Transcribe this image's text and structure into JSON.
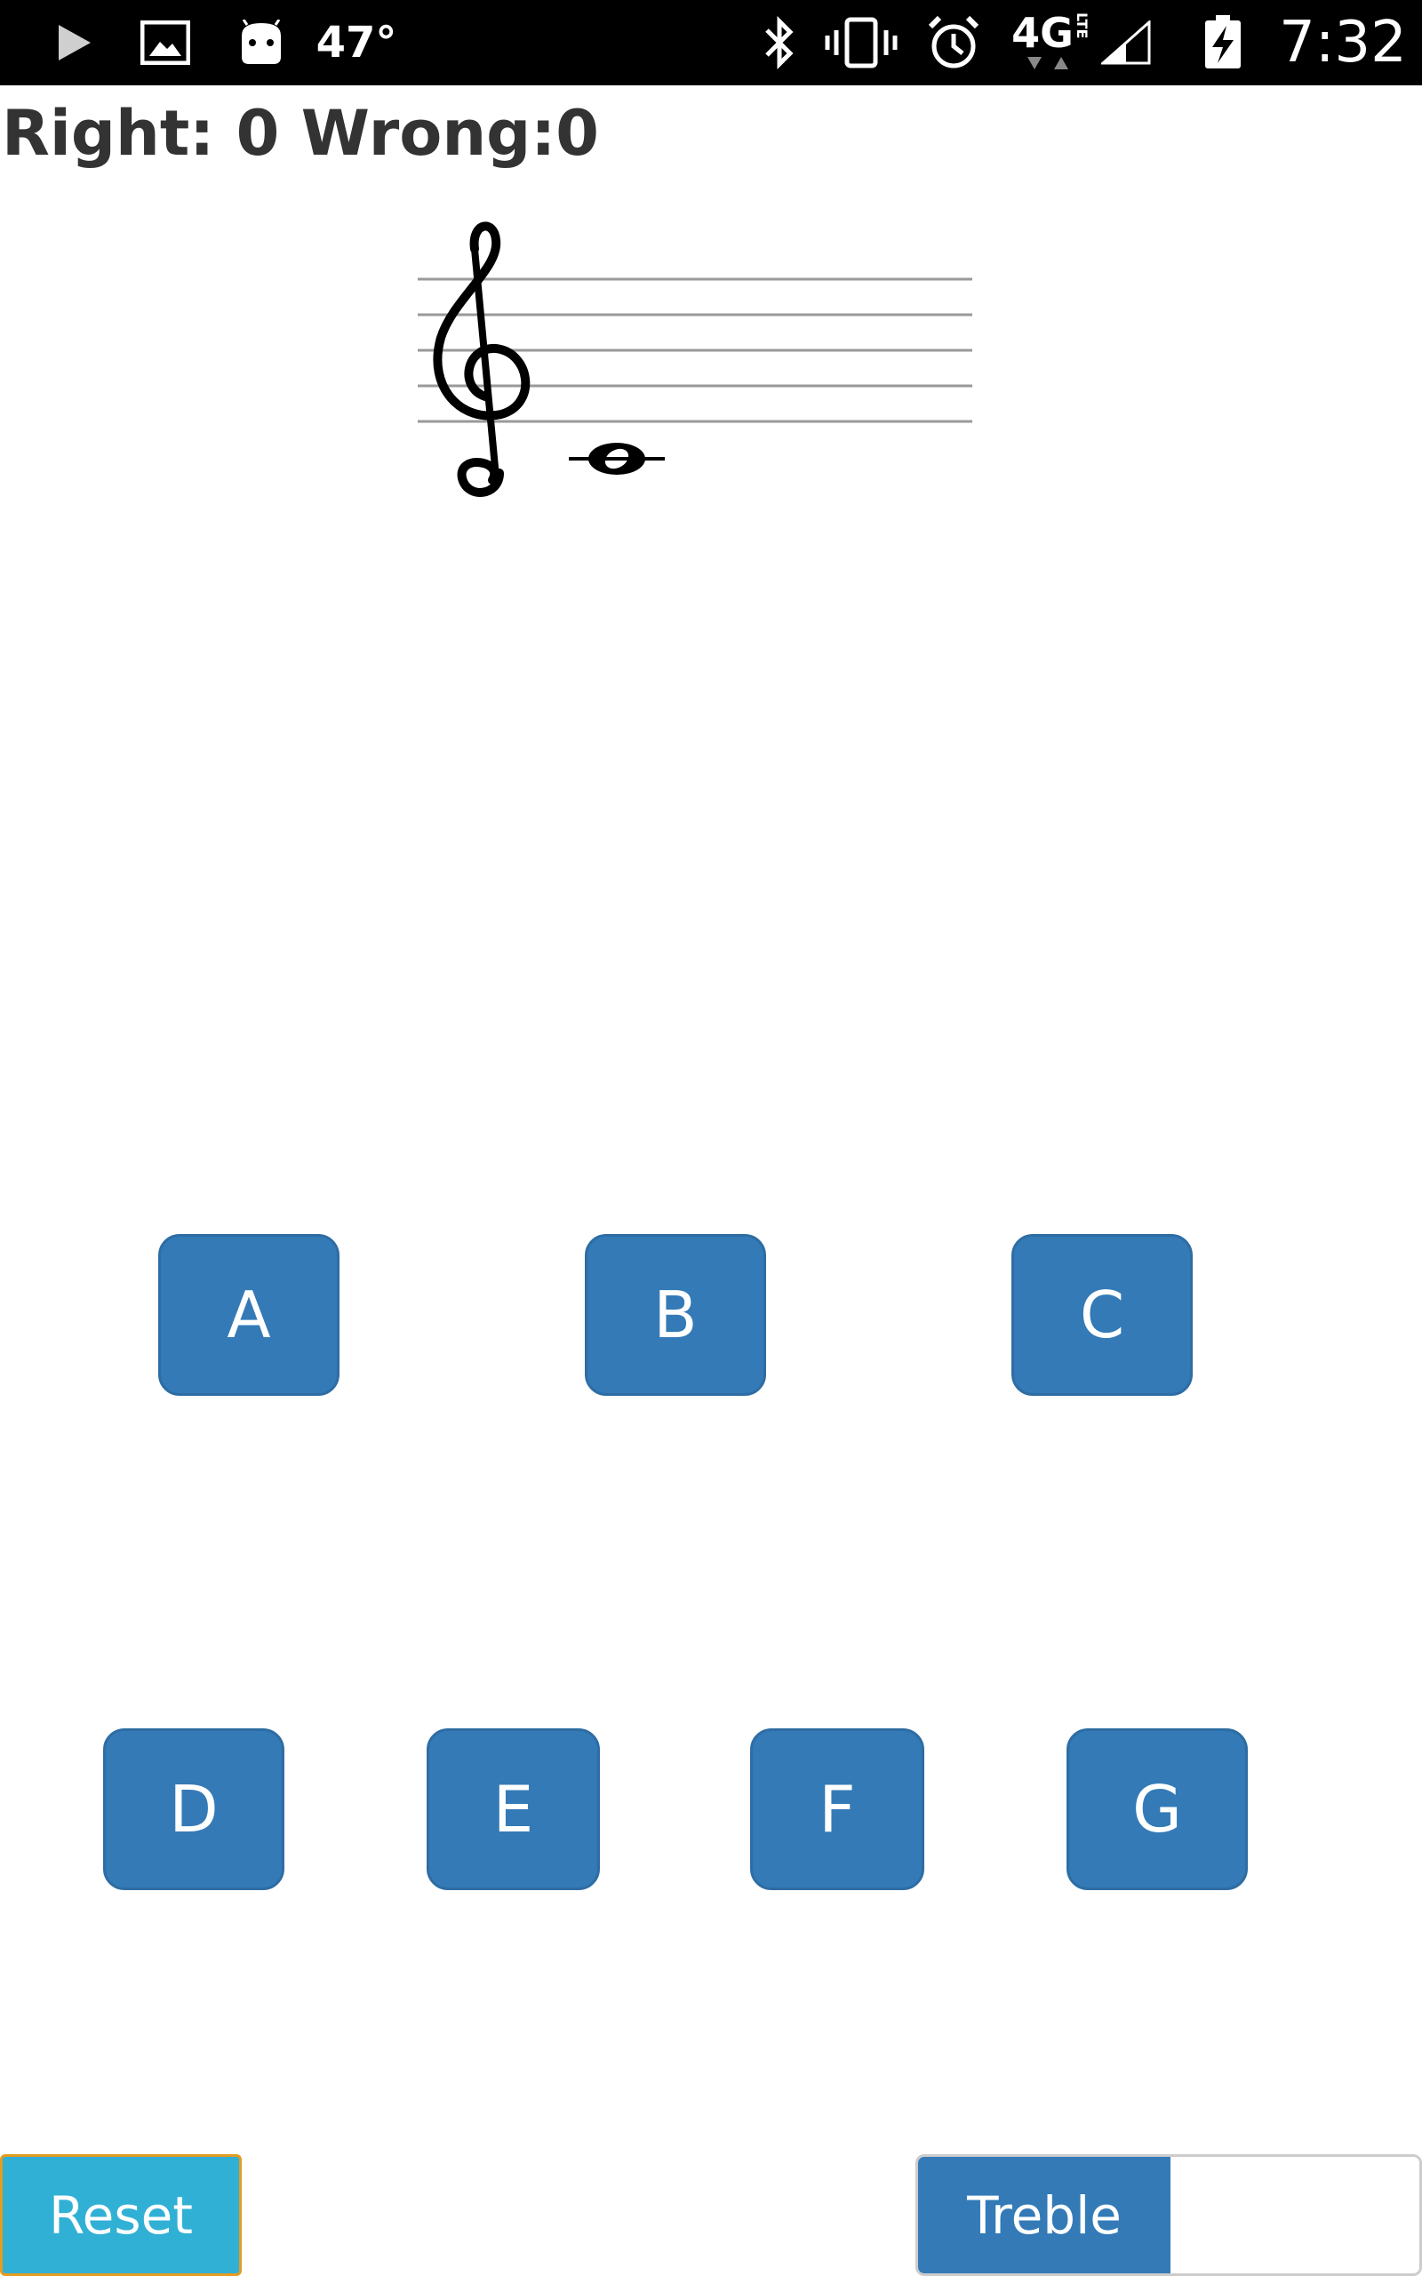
{
  "status_bar": {
    "temperature": "47°",
    "time": "7:32",
    "network": "4G",
    "network_sub": "LTE",
    "icons": [
      "play-store-icon",
      "gallery-icon",
      "android-icon",
      "bluetooth-icon",
      "vibrate-icon",
      "alarm-icon",
      "signal-icon",
      "battery-charging-icon"
    ]
  },
  "score": {
    "text": "Right: 0 Wrong:0"
  },
  "staff": {
    "clef": "treble",
    "note": "middle C whole note on ledger line"
  },
  "buttons": {
    "row1": [
      "A",
      "B",
      "C"
    ],
    "row2": [
      "D",
      "E",
      "F",
      "G"
    ]
  },
  "controls": {
    "reset_label": "Reset",
    "clef_toggle_label": "Treble"
  },
  "colors": {
    "button_primary": "#337ab7",
    "reset_info": "#31b0d5"
  }
}
